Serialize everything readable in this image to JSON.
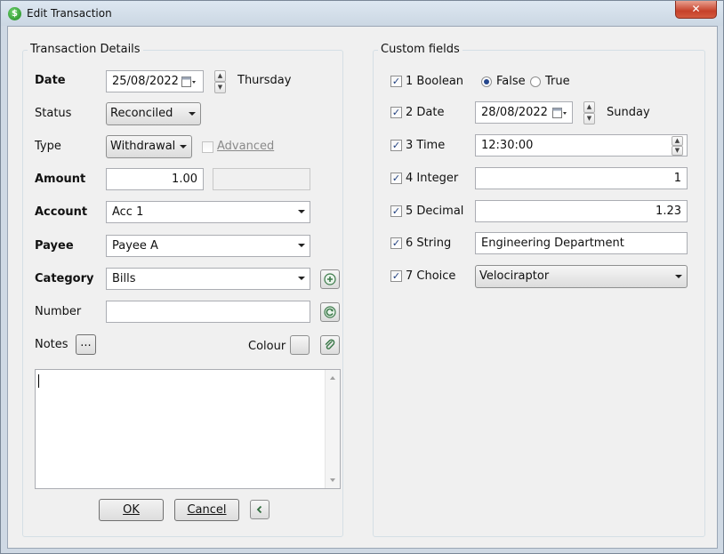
{
  "window": {
    "title": "Edit Transaction",
    "close_label": "✕",
    "app_icon": "$"
  },
  "details": {
    "legend": "Transaction Details",
    "date": {
      "label": "Date",
      "value": "25/08/2022",
      "weekday": "Thursday"
    },
    "status": {
      "label": "Status",
      "value": "Reconciled"
    },
    "type": {
      "label": "Type",
      "value": "Withdrawal",
      "advanced_label": "Advanced",
      "advanced_checked": false
    },
    "amount": {
      "label": "Amount",
      "value": "1.00",
      "secondary_value": ""
    },
    "account": {
      "label": "Account",
      "value": "Acc 1"
    },
    "payee": {
      "label": "Payee",
      "value": "Payee A"
    },
    "category": {
      "label": "Category",
      "value": "Bills"
    },
    "number": {
      "label": "Number",
      "value": ""
    },
    "notes": {
      "label": "Notes",
      "button_label": "...",
      "value": ""
    },
    "colour": {
      "label": "Colour"
    }
  },
  "buttons": {
    "ok": "OK",
    "cancel": "Cancel",
    "collapse": "<"
  },
  "custom": {
    "legend": "Custom fields",
    "boolean": {
      "label": "1 Boolean",
      "checked": true,
      "false_label": "False",
      "true_label": "True",
      "selected": "False"
    },
    "date": {
      "label": "2 Date",
      "checked": true,
      "value": "28/08/2022",
      "weekday": "Sunday"
    },
    "time": {
      "label": "3 Time",
      "checked": true,
      "value": "12:30:00"
    },
    "integer": {
      "label": "4 Integer",
      "checked": true,
      "value": "1"
    },
    "decimal": {
      "label": "5 Decimal",
      "checked": true,
      "value": "1.23"
    },
    "string": {
      "label": "6 String",
      "checked": true,
      "value": "Engineering Department"
    },
    "choice": {
      "label": "7 Choice",
      "checked": true,
      "value": "Velociraptor"
    }
  },
  "colors": {
    "accent": "#24468c",
    "window_frame": "#cfd9e4",
    "client_bg": "#f0f0f0",
    "icon_green": "#1e8a1e",
    "close_red": "#c6412a"
  },
  "icons": {
    "calendar": "calendar-icon",
    "add": "plus-circle-icon",
    "refresh": "refresh-icon",
    "attach": "paperclip-icon"
  }
}
